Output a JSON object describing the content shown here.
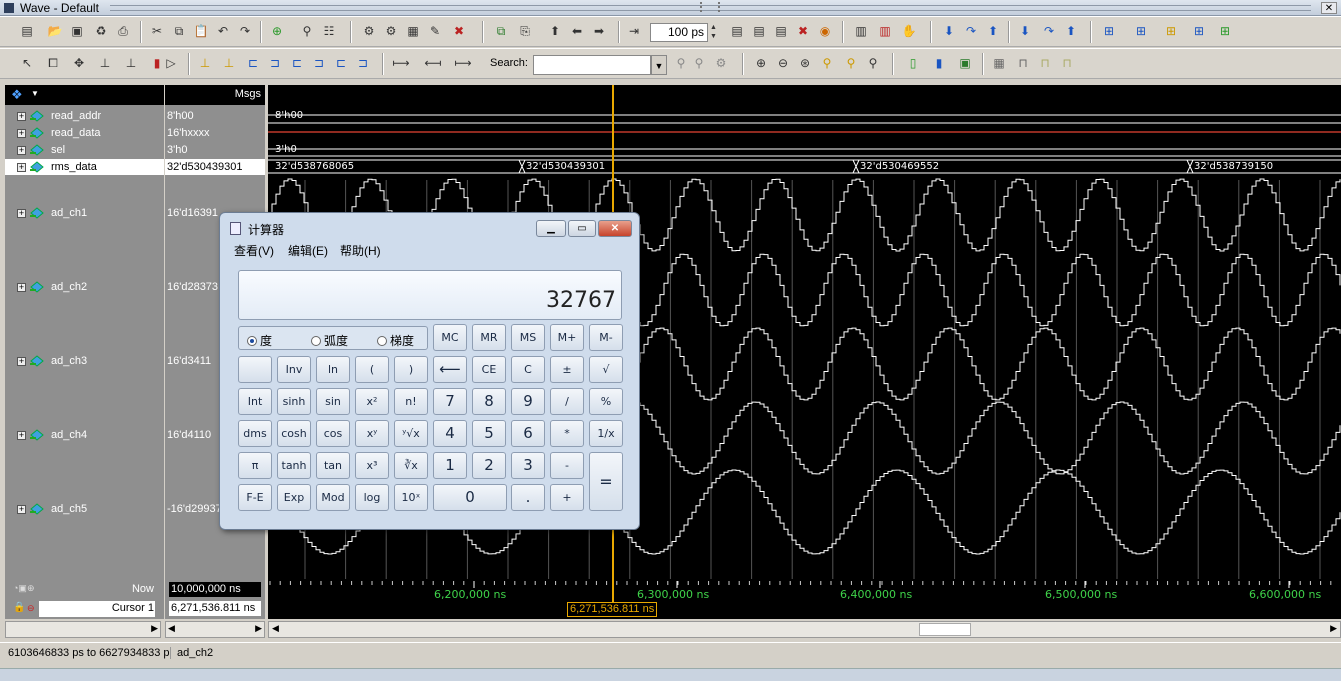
{
  "window": {
    "title": "Wave - Default",
    "close_label": "✕"
  },
  "toolbar": {
    "zoom_value": "100 ps",
    "search_label": "Search:",
    "search_value": ""
  },
  "headers": {
    "msgs": "Msgs"
  },
  "signals": [
    {
      "name": "read_addr",
      "value": "8'h00"
    },
    {
      "name": "read_data",
      "value": "16'hxxxx"
    },
    {
      "name": "sel",
      "value": "3'h0"
    },
    {
      "name": "rms_data",
      "value": "32'd530439301"
    },
    {
      "name": "ad_ch1",
      "value": "16'd16391"
    },
    {
      "name": "ad_ch2",
      "value": "16'd28373"
    },
    {
      "name": "ad_ch3",
      "value": "16'd3411"
    },
    {
      "name": "ad_ch4",
      "value": "16'd4110"
    },
    {
      "name": "ad_ch5",
      "value": "-16'd29937"
    }
  ],
  "wave_labels": {
    "read_addr": "8'h00",
    "sel": "3'h0",
    "rms_0": "32'd538768065",
    "rms_1": "32'd530439301",
    "rms_2": "32'd530469552",
    "rms_3": "32'd538739150"
  },
  "bottom": {
    "now_label": "Now",
    "now_value": "10,000,000 ns",
    "cursor_label": "Cursor 1",
    "cursor_value": "6,271,536.811 ns",
    "cursor_flag": "6,271,536.811 ns"
  },
  "timeline": [
    "6,200,000 ns",
    "6,300,000 ns",
    "6,400,000 ns",
    "6,500,000 ns",
    "6,600,000 ns"
  ],
  "status": {
    "range": "6103646833 ps to 6627934833 p",
    "selected": "ad_ch2"
  },
  "calculator": {
    "title": "计算器",
    "menu": [
      "查看(V)",
      "编辑(E)",
      "帮助(H)"
    ],
    "display": "32767",
    "radios": [
      "度",
      "弧度",
      "梯度"
    ],
    "rows": [
      [
        "MC",
        "MR",
        "MS",
        "M+",
        "M-"
      ],
      [
        "",
        "Inv",
        "ln",
        "(",
        ")",
        "⟵",
        "CE",
        "C",
        "±",
        "√"
      ],
      [
        "Int",
        "sinh",
        "sin",
        "x²",
        "n!",
        "7",
        "8",
        "9",
        "/",
        "%"
      ],
      [
        "dms",
        "cosh",
        "cos",
        "xʸ",
        "ʸ√x",
        "4",
        "5",
        "6",
        "*",
        "1/x"
      ],
      [
        "π",
        "tanh",
        "tan",
        "x³",
        "∛x",
        "1",
        "2",
        "3",
        "-",
        "="
      ],
      [
        "F-E",
        "Exp",
        "Mod",
        "log",
        "10ˣ",
        "0",
        ".",
        "+"
      ]
    ]
  },
  "colors": {
    "wave": "#ffffff",
    "cursor": "#e8a800",
    "timeline": "#3fd34a",
    "read_data": "#c0392b"
  }
}
